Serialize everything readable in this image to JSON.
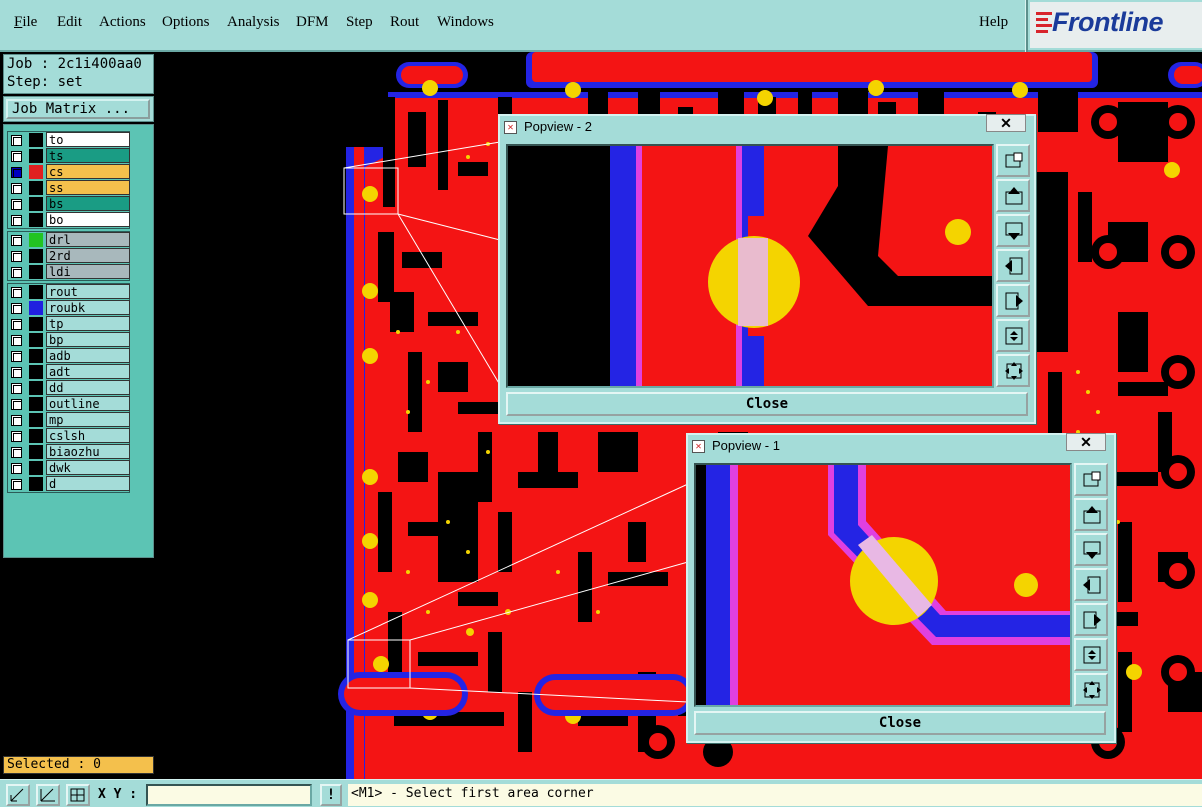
{
  "menubar": {
    "items": [
      "File",
      "Edit",
      "Actions",
      "Options",
      "Analysis",
      "DFM",
      "Step",
      "Rout",
      "Windows"
    ],
    "help": "Help",
    "logo": "Frontline"
  },
  "job": {
    "job_line": "Job : 2c1i400aa0",
    "step_line": "Step: set",
    "matrix_button": "Job Matrix ..."
  },
  "layers": {
    "board": [
      {
        "name": "to",
        "color": "#ffffff"
      },
      {
        "name": "ts",
        "color": "#1a9c84"
      },
      {
        "name": "cs",
        "color": "#f4c04c",
        "swatch": "#e02020",
        "active": true
      },
      {
        "name": "ss",
        "color": "#f4c04c"
      },
      {
        "name": "bs",
        "color": "#1a9c84"
      },
      {
        "name": "bo",
        "color": "#ffffff"
      }
    ],
    "drill": [
      {
        "name": "drl",
        "color": "#a8b8bc",
        "swatch": "#22c422"
      },
      {
        "name": "2rd",
        "color": "#a8b8bc"
      },
      {
        "name": "ldi",
        "color": "#a8b8bc"
      }
    ],
    "misc": [
      {
        "name": "rout",
        "color": "#a4dcd8"
      },
      {
        "name": "roubk",
        "color": "#a4dcd8",
        "swatch": "#2020e0"
      },
      {
        "name": "tp",
        "color": "#a4dcd8"
      },
      {
        "name": "bp",
        "color": "#a4dcd8"
      },
      {
        "name": "adb",
        "color": "#a4dcd8"
      },
      {
        "name": "adt",
        "color": "#a4dcd8"
      },
      {
        "name": "dd",
        "color": "#a4dcd8"
      },
      {
        "name": "outline",
        "color": "#a4dcd8"
      },
      {
        "name": "mp",
        "color": "#a4dcd8"
      },
      {
        "name": "cslsh",
        "color": "#a4dcd8"
      },
      {
        "name": "biaozhu",
        "color": "#a4dcd8"
      },
      {
        "name": "dwk",
        "color": "#a4dcd8"
      },
      {
        "name": "d",
        "color": "#a4dcd8"
      }
    ]
  },
  "selected": "Selected : 0",
  "status": {
    "xy_label": "X Y :",
    "xy_value": "",
    "message": "<M1> - Select first area corner",
    "msg_button": "!"
  },
  "popviews": [
    {
      "title": "Popview - 2",
      "close_label": "Close"
    },
    {
      "title": "Popview - 1",
      "close_label": "Close"
    }
  ],
  "colors": {
    "copper": "#f41414",
    "rout": "#2424e4",
    "pad": "#f4d400",
    "panel": "#a4dcd8",
    "layer_list_bg": "#5cc4b4"
  }
}
